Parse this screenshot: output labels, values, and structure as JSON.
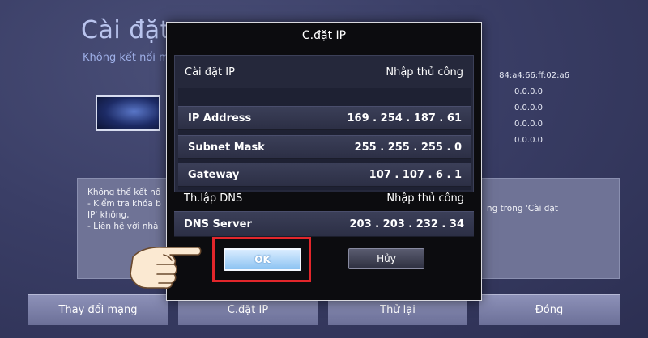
{
  "background": {
    "title": "Cài đặt m",
    "subtitle": "Không kết nối m",
    "network_values": [
      "84:a4:66:ff:02:a6",
      "0.0.0.0",
      "0.0.0.0",
      "0.0.0.0",
      "0.0.0.0"
    ],
    "message_left": [
      "Không thể kết nố",
      "- Kiểm tra khóa b",
      "IP' không,",
      "- Liên hệ với nhà"
    ],
    "message_right": [
      "ng trong 'Cài đặt"
    ],
    "buttons": [
      "Thay đổi mạng",
      "C.đặt IP",
      "Thử lại",
      "Đóng"
    ]
  },
  "dialog": {
    "title": "C.đặt IP",
    "ip_setting": {
      "label": "Cài đặt IP",
      "value": "Nhập thủ công"
    },
    "ip_address": {
      "label": "IP Address",
      "value": "169 . 254 . 187 . 61"
    },
    "subnet_mask": {
      "label": "Subnet Mask",
      "value": "255 . 255 . 255 . 0"
    },
    "gateway": {
      "label": "Gateway",
      "value": "107 . 107 . 6 . 1"
    },
    "dns_setting": {
      "label": "Th.lập DNS",
      "value": "Nhập thủ công"
    },
    "dns_server": {
      "label": "DNS Server",
      "value": "203 . 203 . 232 . 34"
    },
    "ok_label": "OK",
    "cancel_label": "Hủy"
  },
  "colors": {
    "highlight_box": "#e3262b",
    "ok_button": "#a8d2f5",
    "dialog_bg": "#0c0c0f",
    "screen_bg": "#3a3e66"
  },
  "icons": {
    "pointer": "hand-pointer-icon"
  }
}
